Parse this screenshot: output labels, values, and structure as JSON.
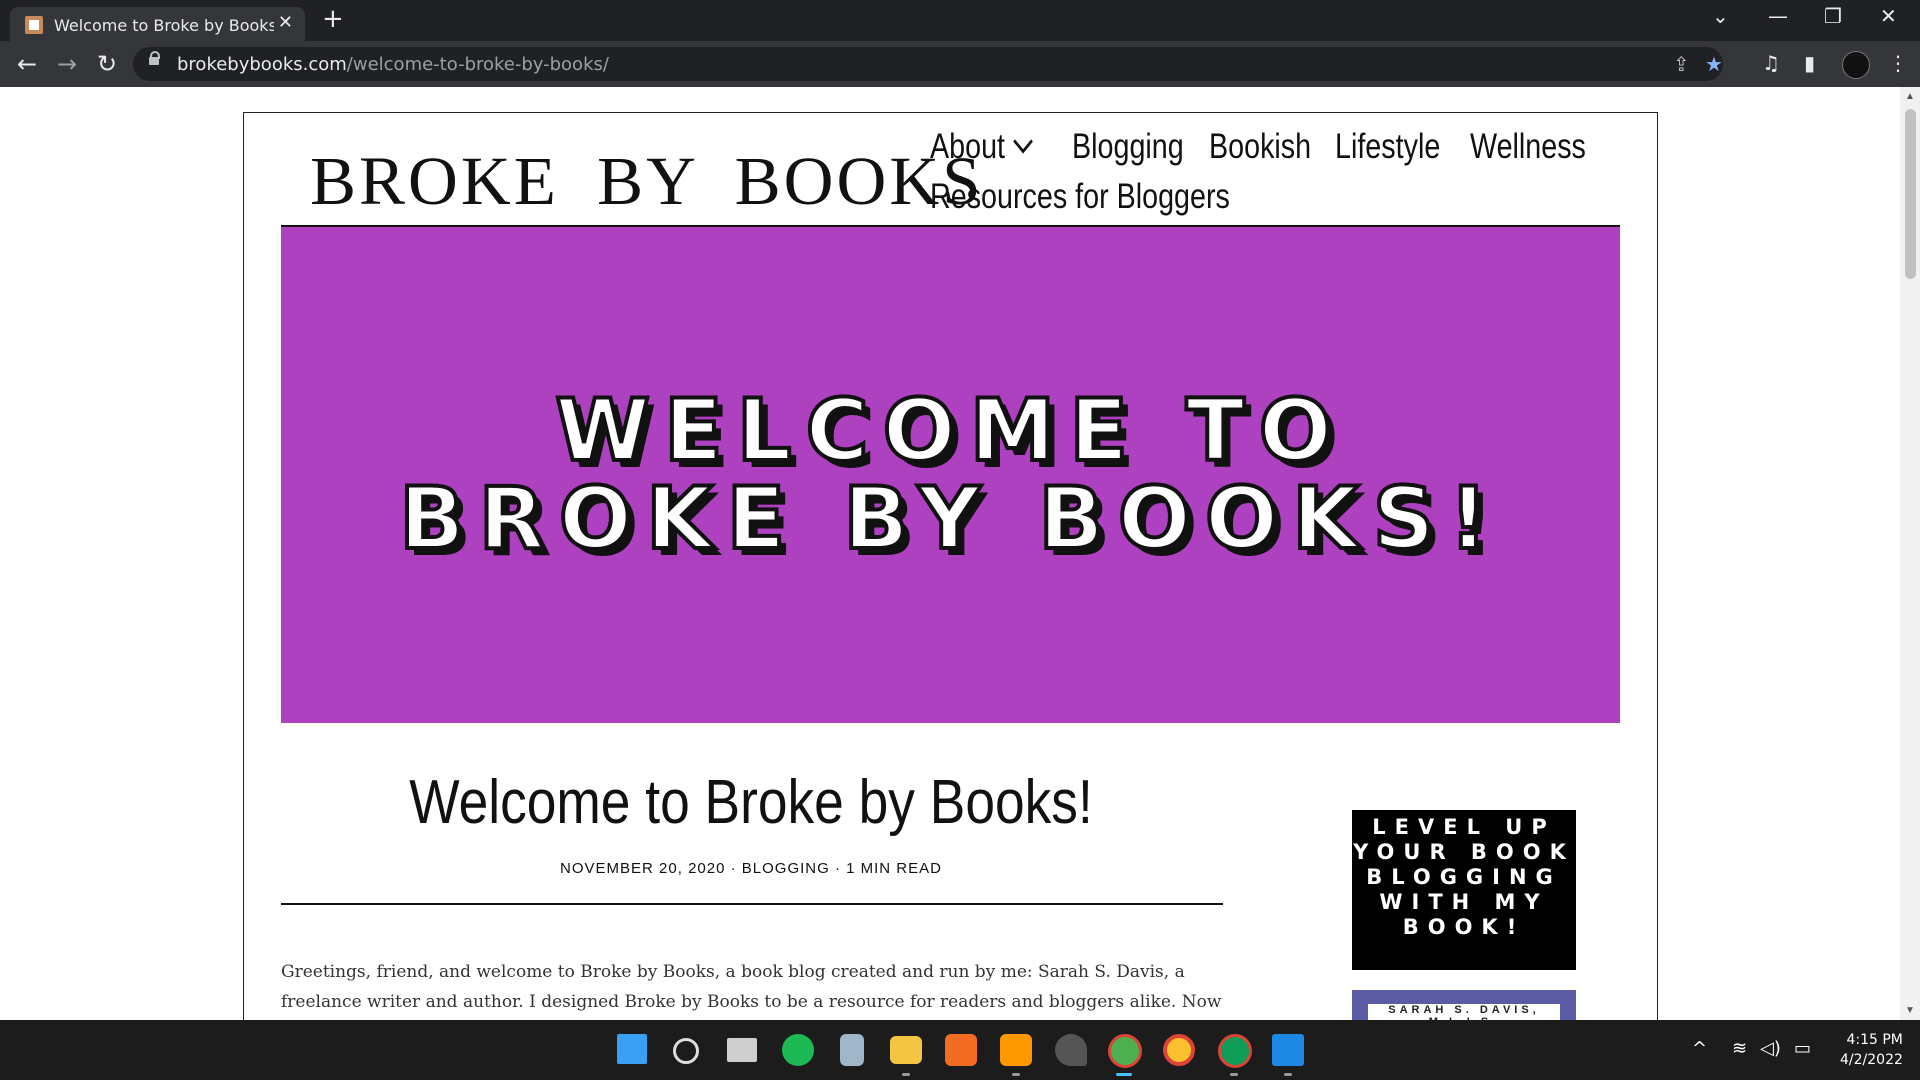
{
  "browser": {
    "tab_title": "Welcome to Broke by Books! - Br",
    "tab_close": "✕",
    "new_tab": "+",
    "url_domain": "brokebybooks.com",
    "url_path": "/welcome-to-broke-by-books/",
    "back": "←",
    "forward": "→",
    "reload": "↻",
    "controls": {
      "menu_down": "⌄",
      "minimize": "—",
      "restore": "❐",
      "close": "✕"
    },
    "toolbar_icons": {
      "share": "⇪",
      "bookmark": "★",
      "media": "♫",
      "sidepanel": "▮",
      "more": "⋮"
    }
  },
  "site": {
    "logo": "BROKE BY BOOKS",
    "menu": {
      "about": "About",
      "blogging": "Blogging",
      "bookish": "Bookish",
      "lifestyle": "Lifestyle",
      "wellness": "Wellness",
      "resources": "Resources for Bloggers"
    },
    "hero": {
      "line1": "WELCOME TO",
      "line2": "BROKE BY BOOKS!",
      "bg": "#ad41c0"
    },
    "post": {
      "title": "Welcome to Broke by Books!",
      "meta": "NOVEMBER 20, 2020 ·  BLOGGING · 1 MIN READ",
      "body": "Greetings, friend, and welcome to Broke by Books, a book blog created and run by me: Sarah S. Davis, a freelance writer and author. I designed Broke by Books to be a resource for readers and bloggers alike. Now in its sixth year,"
    },
    "sidebar": {
      "ad_text": "LEVEL UP YOUR BOOK BLOGGING WITH MY BOOK!",
      "ad2_text": "SARAH S. DAVIS, M.L.I.S."
    }
  },
  "taskbar": {
    "clock_time": "4:15 PM",
    "clock_date": "4/2/2022",
    "tray": {
      "chevron": "^",
      "wifi": "≋",
      "volume": "◁)",
      "battery": "▭"
    }
  }
}
